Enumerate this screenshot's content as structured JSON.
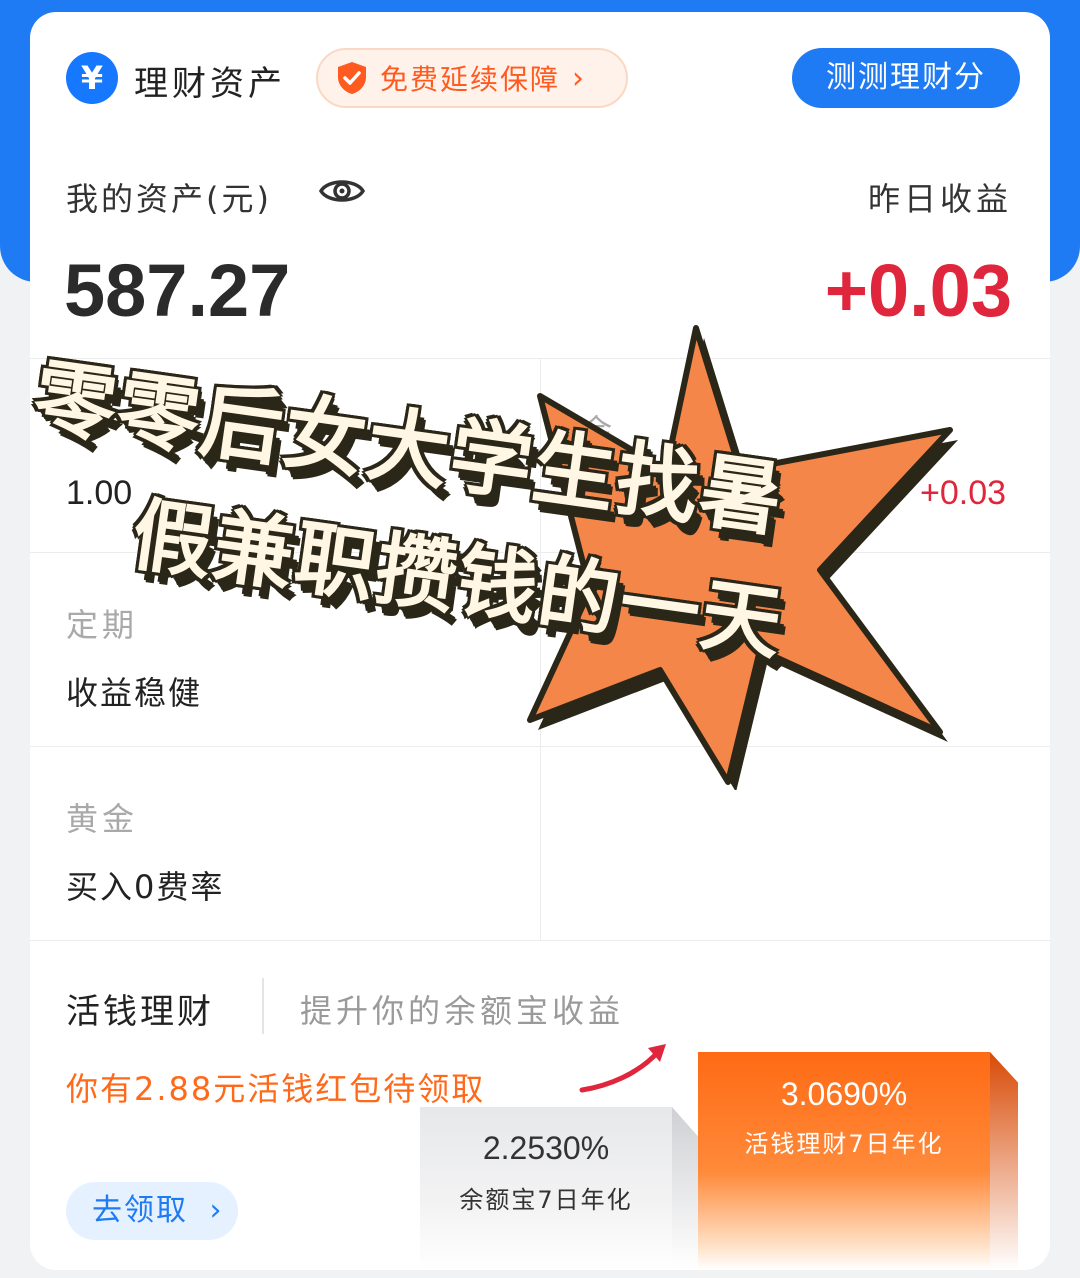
{
  "header": {
    "brand_icon": "yen-icon",
    "brand_icon_glyph": "¥",
    "title": "理财资产",
    "promo_label": "免费延续保障",
    "score_button": "测测理财分"
  },
  "assets": {
    "label": "我的资产(元)",
    "value": "587.27",
    "yesterday_label": "昨日收益",
    "yesterday_value": "+0.03"
  },
  "grid": {
    "left_num": "1.00",
    "right_label_partial": "余",
    "right_num": "+0.03",
    "fixed_label": "定期",
    "fixed_value": "收益稳健",
    "gold_label": "黄金",
    "gold_value": "买入0费率"
  },
  "flexible": {
    "title": "活钱理财",
    "subtitle": "提升你的余额宝收益",
    "red_packet": "你有2.88元活钱红包待领取",
    "claim_button": "去领取",
    "claim_chevron": "›",
    "bar_low": {
      "rate": "2.2530%",
      "caption": "余额宝7日年化"
    },
    "bar_high": {
      "rate": "3.0690%",
      "caption": "活钱理财7日年化"
    }
  },
  "overlay": {
    "line1": "零零后女大学生找暑",
    "line2": "假兼职攒钱的一天"
  },
  "colors": {
    "brand_blue": "#1e7bf3",
    "profit_red": "#e0263c",
    "accent_orange": "#ff6a1a",
    "burst_orange": "#f5864a"
  }
}
